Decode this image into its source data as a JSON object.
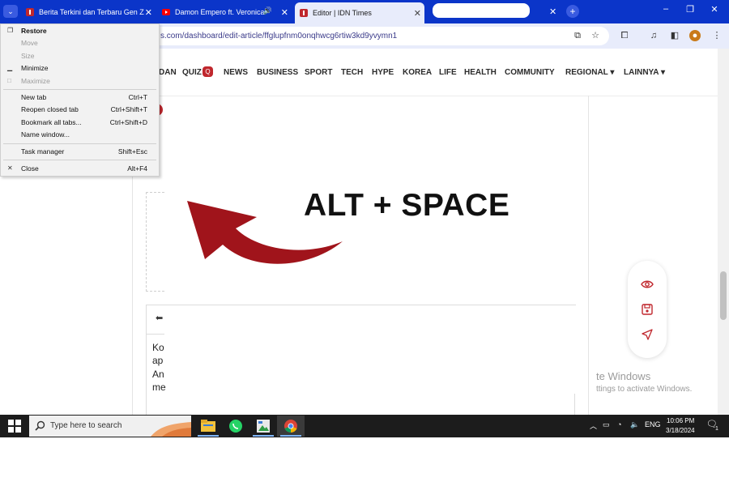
{
  "browser": {
    "tabs": [
      {
        "title": "Berita Terkini dan Terbaru Gen Z",
        "active": false
      },
      {
        "title": "Damon Empero ft. Veronica",
        "active": false,
        "audio": true
      },
      {
        "title": "Editor | IDN Times",
        "active": true
      },
      {
        "title": "",
        "active": false
      }
    ],
    "url": "s.com/dashboard/edit-article/ffglupfnm0onqhwcg6rtiw3kd9yvymn1",
    "new_tab_symbol": "+",
    "window_controls": [
      "–",
      "❐",
      "✕"
    ]
  },
  "site_nav": {
    "items": [
      "DAN",
      "QUIZ",
      "NEWS",
      "BUSINESS",
      "SPORT",
      "TECH",
      "HYPE",
      "KOREA",
      "LIFE",
      "HEALTH",
      "COMMUNITY",
      "REGIONAL",
      "LAINNYA"
    ],
    "quiz_badge": "Q",
    "dropdown_marker": "▾"
  },
  "overlay_text": "ALT + SPACE",
  "editor": {
    "text_fragments": [
      "Ko",
      "ap",
      "An",
      "me"
    ]
  },
  "system_menu": {
    "items": [
      {
        "label": "Restore",
        "shortcut": "",
        "disabled": false,
        "bold": true,
        "icon": "restore-icon"
      },
      {
        "label": "Move",
        "shortcut": "",
        "disabled": true,
        "bold": false,
        "icon": ""
      },
      {
        "label": "Size",
        "shortcut": "",
        "disabled": true,
        "bold": false,
        "icon": ""
      },
      {
        "label": "Minimize",
        "shortcut": "",
        "disabled": false,
        "bold": false,
        "icon": "minimize-icon"
      },
      {
        "label": "Maximize",
        "shortcut": "",
        "disabled": true,
        "bold": false,
        "icon": "maximize-icon"
      },
      {
        "label": "New tab",
        "shortcut": "Ctrl+T",
        "disabled": false,
        "bold": false,
        "icon": ""
      },
      {
        "label": "Reopen closed tab",
        "shortcut": "Ctrl+Shift+T",
        "disabled": false,
        "bold": false,
        "icon": ""
      },
      {
        "label": "Bookmark all tabs...",
        "shortcut": "Ctrl+Shift+D",
        "disabled": false,
        "bold": false,
        "icon": ""
      },
      {
        "label": "Name window...",
        "shortcut": "",
        "disabled": false,
        "bold": false,
        "icon": ""
      },
      {
        "label": "Task manager",
        "shortcut": "Shift+Esc",
        "disabled": false,
        "bold": false,
        "icon": ""
      },
      {
        "label": "Close",
        "shortcut": "Alt+F4",
        "disabled": false,
        "bold": false,
        "icon": "close-icon"
      }
    ]
  },
  "windows_watermark": {
    "line1": "te Windows",
    "line2": "ttings to activate Windows."
  },
  "taskbar": {
    "search_placeholder": "Type here to search",
    "language": "ENG",
    "time": "10:06 PM",
    "date": "3/18/2024",
    "notification_count": "1"
  },
  "colors": {
    "tab_strip": "#0b35c9",
    "toolbar": "#e8ecfb",
    "accent_red": "#a0141b",
    "badge_red": "#c0272d",
    "taskbar": "#1c1c1c"
  }
}
